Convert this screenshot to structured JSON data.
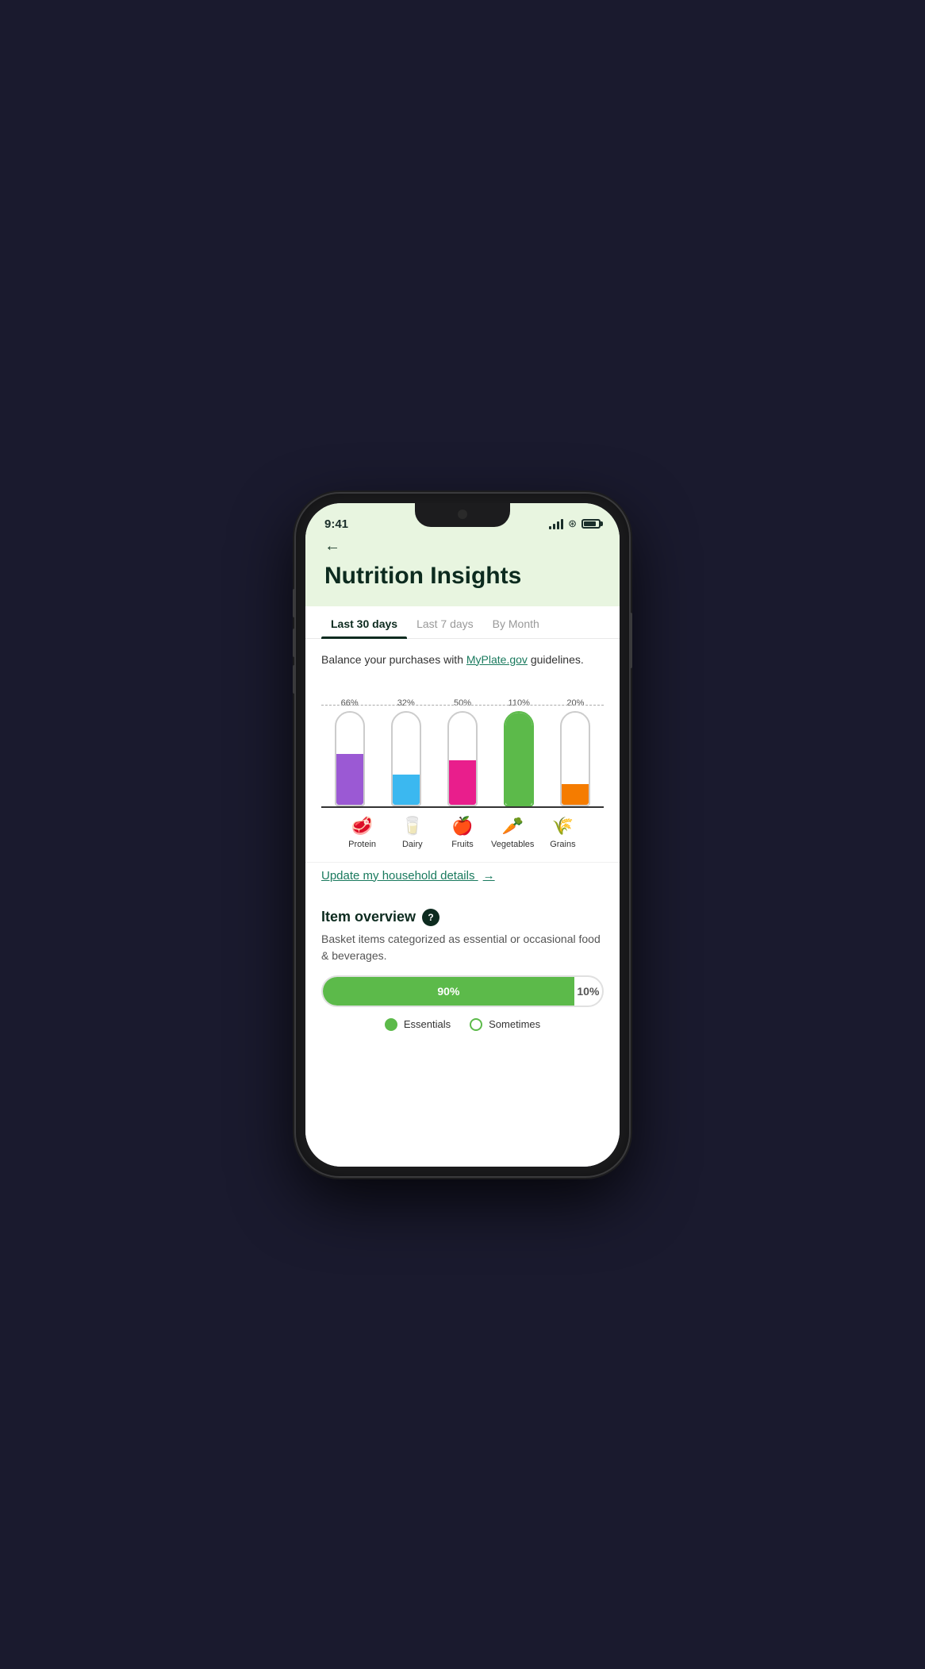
{
  "phone": {
    "time": "9:41",
    "signal_bars": [
      4,
      7,
      10,
      13
    ],
    "battery_level": "85%"
  },
  "header": {
    "back_label": "←",
    "title": "Nutrition Insights"
  },
  "tabs": [
    {
      "id": "last30",
      "label": "Last 30 days",
      "active": true
    },
    {
      "id": "last7",
      "label": "Last 7 days",
      "active": false
    },
    {
      "id": "bymonth",
      "label": "By Month",
      "active": false
    }
  ],
  "chart": {
    "intro_text": "Balance your purchases with",
    "myplate_link": "MyPlate.gov",
    "intro_suffix": " guidelines.",
    "bars": [
      {
        "id": "protein",
        "label": "Protein",
        "percentage": "66%",
        "color": "#9b59d4",
        "fill_height": 55,
        "icon": "🥩"
      },
      {
        "id": "dairy",
        "label": "Dairy",
        "percentage": "32%",
        "color": "#3bb8f0",
        "fill_height": 40,
        "icon": "🥛"
      },
      {
        "id": "fruits",
        "label": "Fruits",
        "percentage": "50%",
        "color": "#e91e8c",
        "fill_height": 50,
        "icon": "🍎"
      },
      {
        "id": "vegetables",
        "label": "Vegetables",
        "percentage": "110%",
        "color": "#5cba4a",
        "fill_height": 120,
        "icon": "🥕"
      },
      {
        "id": "grains",
        "label": "Grains",
        "percentage": "20%",
        "color": "#f57c00",
        "fill_height": 28,
        "icon": "🌾"
      }
    ]
  },
  "update_link": {
    "text": "Update my household details",
    "arrow": "→"
  },
  "item_overview": {
    "title": "Item overview",
    "help_icon": "?",
    "description": "Basket items categorized as essential or occasional food & beverages.",
    "progress": {
      "essentials_pct": 90,
      "essentials_label": "90%",
      "sometimes_label": "10%"
    },
    "legend": [
      {
        "id": "essentials",
        "label": "Essentials",
        "filled": true
      },
      {
        "id": "sometimes",
        "label": "Sometimes",
        "filled": false
      }
    ]
  }
}
